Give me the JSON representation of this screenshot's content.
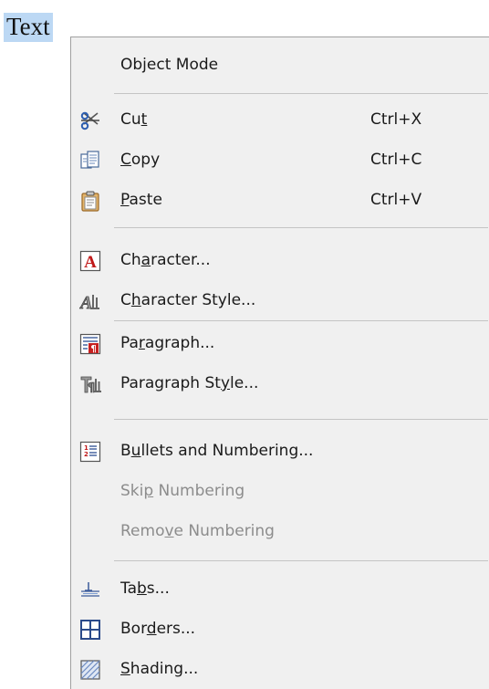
{
  "document": {
    "text": "Text"
  },
  "menu": {
    "object_mode": {
      "pre": "Ob",
      "key": "j",
      "post": "ect Mode"
    },
    "cut": {
      "pre": "Cu",
      "key": "t",
      "post": "",
      "shortcut": "Ctrl+X",
      "icon": "scissors-icon"
    },
    "copy": {
      "pre": "",
      "key": "C",
      "post": "opy",
      "shortcut": "Ctrl+C",
      "icon": "copy-icon"
    },
    "paste": {
      "pre": "",
      "key": "P",
      "post": "aste",
      "shortcut": "Ctrl+V",
      "icon": "paste-clipboard-icon"
    },
    "character": {
      "pre": "Ch",
      "key": "a",
      "post": "racter...",
      "icon": "character-format-icon"
    },
    "character_style": {
      "pre": "C",
      "key": "h",
      "post": "aracter Style...",
      "icon": "character-style-icon"
    },
    "paragraph": {
      "pre": "Pa",
      "key": "r",
      "post": "agraph...",
      "icon": "paragraph-format-icon"
    },
    "paragraph_style": {
      "pre": "Paragraph St",
      "key": "y",
      "post": "le...",
      "icon": "paragraph-style-icon"
    },
    "bullets": {
      "pre": "B",
      "key": "u",
      "post": "llets and Numbering...",
      "icon": "bullets-numbering-icon"
    },
    "skip_numbering": {
      "pre": "Ski",
      "key": "p",
      "post": " Numbering",
      "disabled": true
    },
    "remove_numbering": {
      "pre": "Remo",
      "key": "v",
      "post": "e Numbering",
      "disabled": true
    },
    "tabs": {
      "pre": "Ta",
      "key": "b",
      "post": "s...",
      "icon": "tabs-icon"
    },
    "borders": {
      "pre": "Bor",
      "key": "d",
      "post": "ers...",
      "icon": "borders-icon"
    },
    "shading": {
      "pre": "",
      "key": "S",
      "post": "hading...",
      "icon": "shading-icon"
    }
  }
}
